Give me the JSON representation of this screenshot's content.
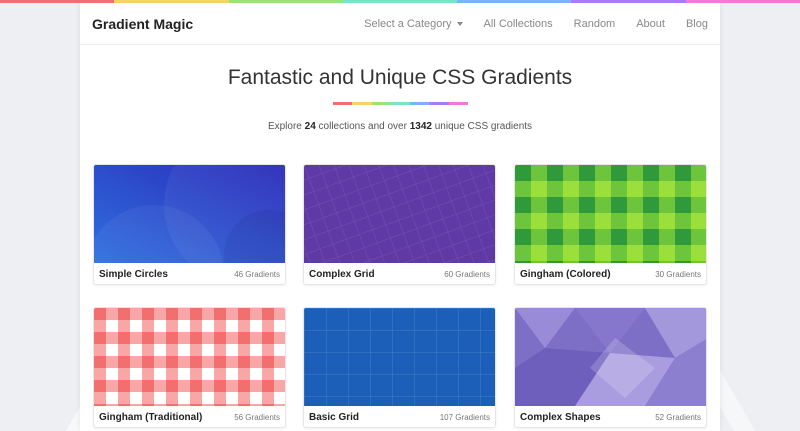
{
  "brand": "Gradient Magic",
  "nav": {
    "category_label": "Select a Category",
    "all_collections": "All Collections",
    "random": "Random",
    "about": "About",
    "blog": "Blog"
  },
  "hero": {
    "title": "Fantastic and Unique CSS Gradients",
    "subtitle_prefix": "Explore ",
    "collections_count": "24",
    "subtitle_middle": " collections and over ",
    "gradients_count": "1342",
    "subtitle_suffix": " unique CSS gradients"
  },
  "rainbow_colors": [
    "#f36f6f",
    "#f7d26b",
    "#98e37c",
    "#7de3c7",
    "#7ab4f5",
    "#a87cf0",
    "#ef7ad9"
  ],
  "cards": [
    {
      "title": "Simple Circles",
      "count": "46 Gradients"
    },
    {
      "title": "Complex Grid",
      "count": "60 Gradients"
    },
    {
      "title": "Gingham (Colored)",
      "count": "30 Gradients"
    },
    {
      "title": "Gingham (Traditional)",
      "count": "56 Gradients"
    },
    {
      "title": "Basic Grid",
      "count": "107 Gradients"
    },
    {
      "title": "Complex Shapes",
      "count": "52 Gradients"
    }
  ]
}
